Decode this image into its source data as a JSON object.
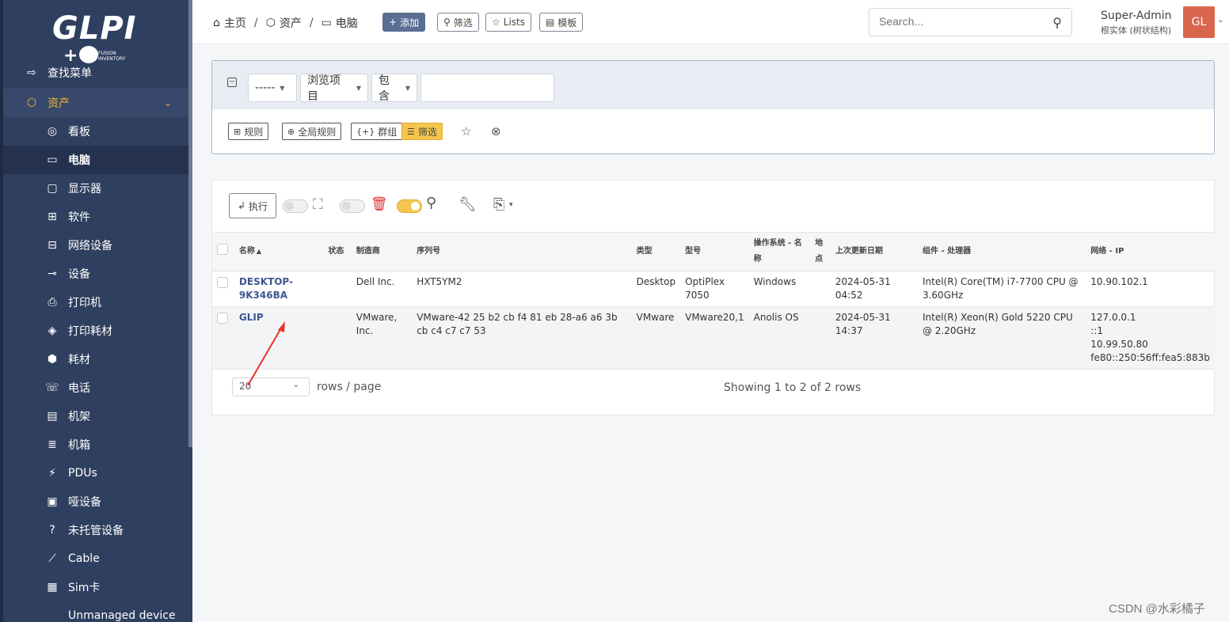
{
  "sidebar": {
    "logo": {
      "glpi": "GLPI",
      "plus": "+",
      "fusion": "FUSION INVENTORY"
    },
    "top_items": [
      {
        "label": "查找菜单",
        "icon": "arrow-right-icon"
      },
      {
        "label": "资产",
        "icon": "cube-icon"
      }
    ],
    "items": [
      {
        "label": "看板",
        "icon": "dashboard-icon"
      },
      {
        "label": "电脑",
        "icon": "laptop-icon"
      },
      {
        "label": "显示器",
        "icon": "monitor-icon"
      },
      {
        "label": "软件",
        "icon": "apps-icon"
      },
      {
        "label": "网络设备",
        "icon": "network-icon"
      },
      {
        "label": "设备",
        "icon": "usb-icon"
      },
      {
        "label": "打印机",
        "icon": "printer-icon"
      },
      {
        "label": "打印耗材",
        "icon": "droplet-icon"
      },
      {
        "label": "耗材",
        "icon": "package-icon"
      },
      {
        "label": "电话",
        "icon": "phone-icon"
      },
      {
        "label": "机架",
        "icon": "server-icon"
      },
      {
        "label": "机箱",
        "icon": "list-icon"
      },
      {
        "label": "PDUs",
        "icon": "plug-icon"
      },
      {
        "label": "哑设备",
        "icon": "square-icon"
      },
      {
        "label": "未托管设备",
        "icon": "question-icon"
      },
      {
        "label": "Cable",
        "icon": "cable-icon"
      },
      {
        "label": "Sim卡",
        "icon": "sim-icon"
      },
      {
        "label": "Unmanaged device",
        "icon": ""
      }
    ]
  },
  "header": {
    "breadcrumbs": [
      "主页",
      "资产",
      "电脑"
    ],
    "buttons": {
      "add": "添加",
      "search": "筛选",
      "lists": "Lists",
      "templates": "模板"
    },
    "search_placeholder": "Search...",
    "user_name": "Super-Admin",
    "user_entity": "根实体 (树状结构)",
    "avatar": "GL"
  },
  "filter": {
    "field_select": "-----",
    "item_select": "浏览项目",
    "operator_select": "包含",
    "value": "",
    "buttons": {
      "rule": "规则",
      "global_rule": "全局规则",
      "group": "群组",
      "search": "筛选"
    }
  },
  "table": {
    "action_button": "执行",
    "columns": [
      "名称",
      "状态",
      "制造商",
      "序列号",
      "类型",
      "型号",
      "操作系统 - 名称",
      "地点",
      "上次更新日期",
      "组件 - 处理器",
      "网络 - IP"
    ],
    "rows": [
      {
        "name": "DESKTOP-9K346BA",
        "status": "",
        "manufacturer": "Dell Inc.",
        "serial": "HXT5YM2",
        "type": "Desktop",
        "model": "OptiPlex 7050",
        "os": "Windows",
        "location": "",
        "updated": "2024-05-31 04:52",
        "cpu": "Intel(R) Core(TM) i7-7700 CPU @ 3.60GHz",
        "ip": [
          "10.90.102.1"
        ]
      },
      {
        "name": "GLIP",
        "status": "",
        "manufacturer": "VMware, Inc.",
        "serial": "VMware-42 25 b2 cb f4 81 eb 28-a6 a6 3b cb c4 c7 c7 53",
        "type": "VMware",
        "model": "VMware20,1",
        "os": "Anolis OS",
        "location": "",
        "updated": "2024-05-31 14:37",
        "cpu": "Intel(R) Xeon(R) Gold 5220 CPU @ 2.20GHz",
        "ip": [
          "127.0.0.1",
          "::1",
          "10.99.50.80",
          "fe80::250:56ff:fea5:883b"
        ]
      }
    ],
    "page_size": "20",
    "rows_per_page_label": "rows / page",
    "showing": "Showing 1 to 2 of 2 rows"
  },
  "watermark": "CSDN @水彩橘子",
  "colors": {
    "sidebar": "#2f3f5f",
    "accent": "#f4b73f",
    "annotation_arrow": "#e8322c"
  }
}
